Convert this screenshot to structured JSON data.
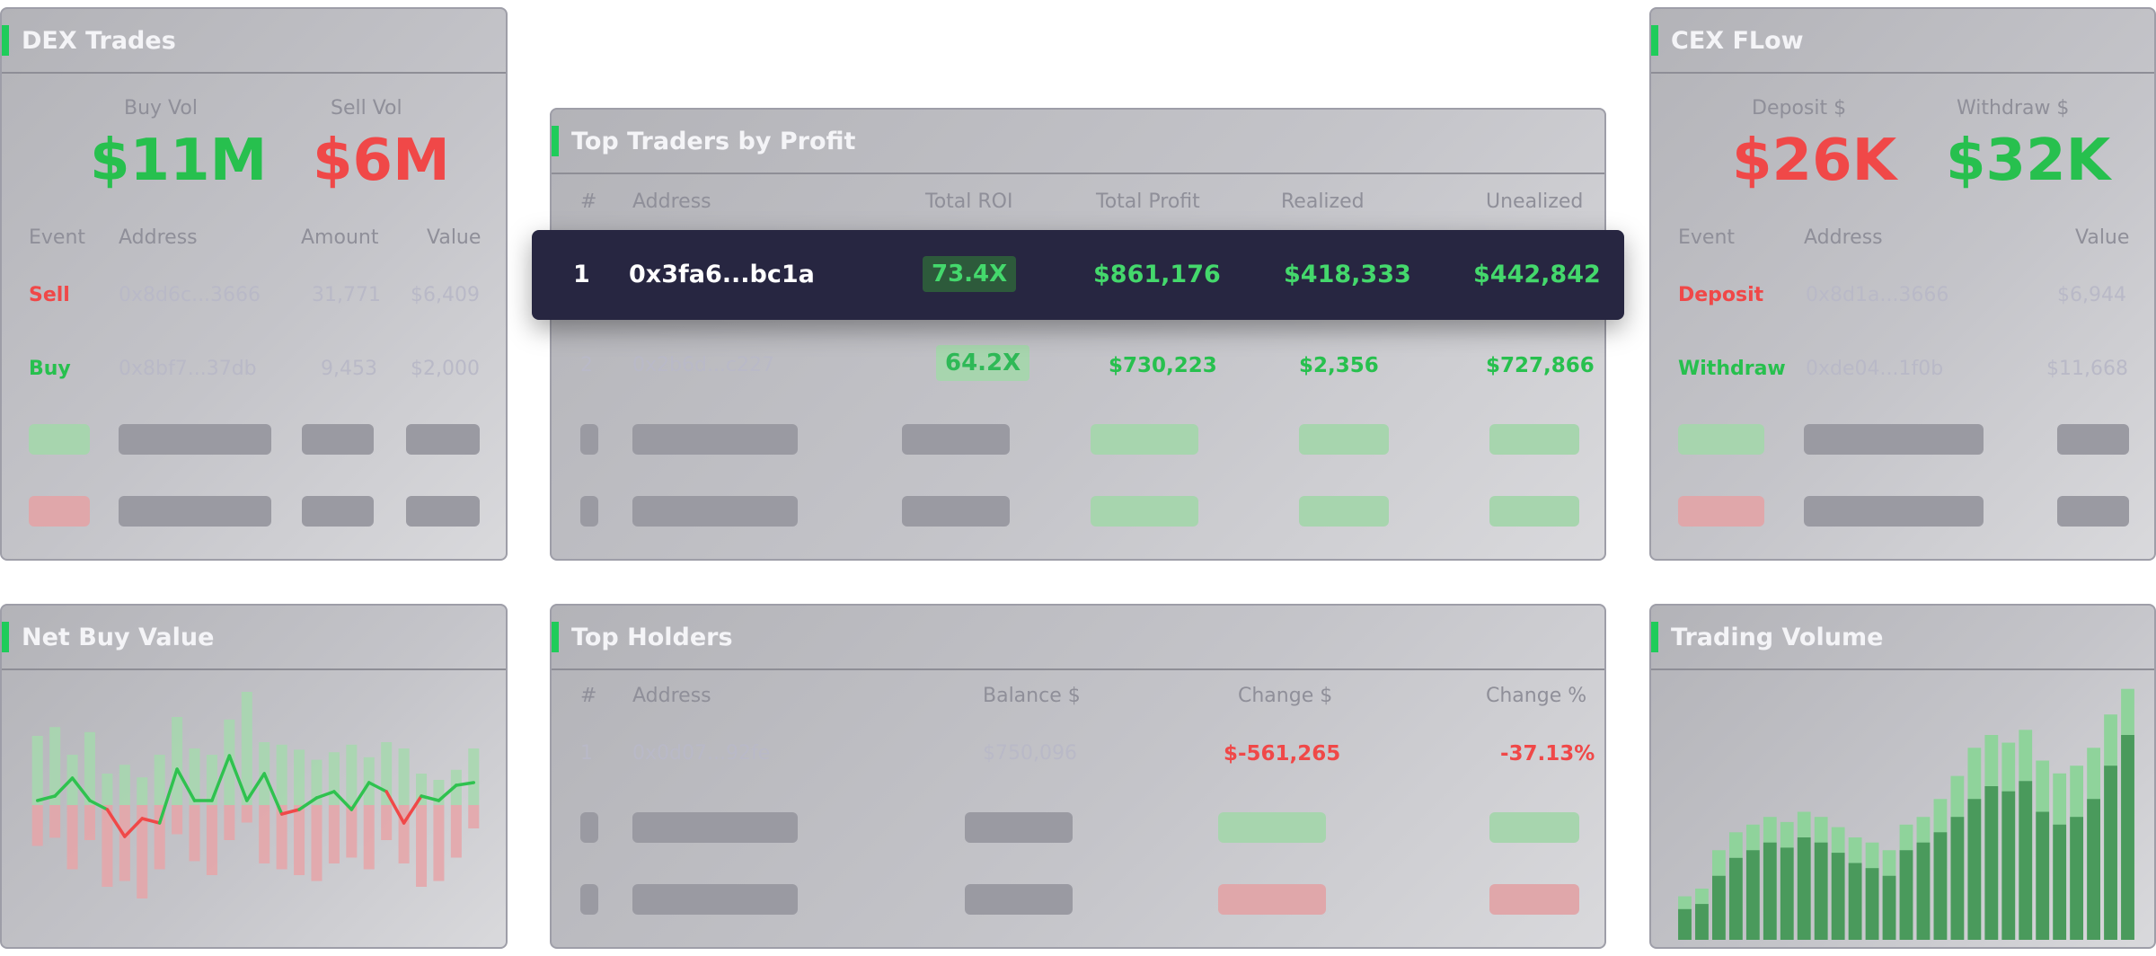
{
  "dex_trades": {
    "title": "DEX Trades",
    "buy_vol_label": "Buy Vol",
    "buy_vol_value": "$11M",
    "sell_vol_label": "Sell Vol",
    "sell_vol_value": "$6M",
    "headers": {
      "event": "Event",
      "address": "Address",
      "amount": "Amount",
      "value": "Value"
    },
    "rows": [
      {
        "event": "Sell",
        "address": "0x8d6c...3666",
        "amount": "31,771",
        "value": "$6,409"
      },
      {
        "event": "Buy",
        "address": "0x8bf7...37db",
        "amount": "9,453",
        "value": "$2,000"
      }
    ]
  },
  "top_traders": {
    "title": "Top Traders by Profit",
    "headers": {
      "rank": "#",
      "address": "Address",
      "roi": "Total ROI",
      "profit": "Total Profit",
      "realized": "Realized",
      "unrealized": "Unealized"
    },
    "rows": [
      {
        "rank": "1",
        "address": "0x3fa6...bc1a",
        "roi": "73.4X",
        "profit": "$861,176",
        "realized": "$418,333",
        "unrealized": "$442,842"
      },
      {
        "rank": "2",
        "address": "0x2b6d...c227",
        "roi": "64.2X",
        "profit": "$730,223",
        "realized": "$2,356",
        "unrealized": "$727,866"
      }
    ]
  },
  "cex_flow": {
    "title": "CEX FLow",
    "deposit_label": "Deposit $",
    "deposit_value": "$26K",
    "withdraw_label": "Withdraw $",
    "withdraw_value": "$32K",
    "headers": {
      "event": "Event",
      "address": "Address",
      "value": "Value"
    },
    "rows": [
      {
        "event": "Deposit",
        "address": "0x8d1a...3666",
        "value": "$6,944"
      },
      {
        "event": "Withdraw",
        "address": "0xde04...1f0b",
        "value": "$11,668"
      }
    ]
  },
  "net_buy_value": {
    "title": "Net Buy Value"
  },
  "top_holders": {
    "title": "Top Holders",
    "headers": {
      "rank": "#",
      "address": "Address",
      "balance": "Balance $",
      "change": "Change $",
      "change_pct": "Change %"
    },
    "rows": [
      {
        "rank": "1",
        "address": "0x0d07...92fe",
        "balance": "$750,096",
        "change": "$-561,265",
        "change_pct": "-37.13%"
      }
    ]
  },
  "trading_volume": {
    "title": "Trading Volume"
  },
  "colors": {
    "green": "#27c04e",
    "red": "#f04848",
    "highlight_row": "#272641",
    "accent": "#1fcc5a"
  },
  "chart_data": [
    {
      "type": "line",
      "title": "Net Buy Value",
      "up_bars": [
        0.55,
        0.62,
        0.4,
        0.58,
        0.25,
        0.32,
        0.22,
        0.4,
        0.7,
        0.45,
        0.4,
        0.68,
        0.9,
        0.5,
        0.48,
        0.44,
        0.36,
        0.42,
        0.48,
        0.38,
        0.5,
        0.45,
        0.25,
        0.2,
        0.28,
        0.45
      ],
      "down_bars": [
        0.35,
        0.28,
        0.55,
        0.3,
        0.7,
        0.65,
        0.8,
        0.55,
        0.25,
        0.48,
        0.6,
        0.3,
        0.15,
        0.5,
        0.55,
        0.6,
        0.65,
        0.5,
        0.45,
        0.55,
        0.3,
        0.5,
        0.7,
        0.65,
        0.45,
        0.2
      ],
      "line": [
        0.05,
        0.1,
        0.3,
        0.05,
        -0.05,
        -0.35,
        -0.15,
        -0.2,
        0.4,
        0.05,
        0.05,
        0.55,
        0.05,
        0.35,
        -0.1,
        -0.05,
        0.08,
        0.15,
        -0.05,
        0.25,
        0.15,
        -0.2,
        0.1,
        0.05,
        0.22,
        0.25
      ]
    },
    {
      "type": "bar",
      "title": "Trading Volume",
      "totals": [
        0.17,
        0.2,
        0.35,
        0.42,
        0.45,
        0.48,
        0.46,
        0.5,
        0.48,
        0.44,
        0.4,
        0.38,
        0.35,
        0.45,
        0.48,
        0.55,
        0.64,
        0.75,
        0.8,
        0.77,
        0.82,
        0.7,
        0.65,
        0.68,
        0.75,
        0.88,
        0.98
      ],
      "inner": [
        0.12,
        0.14,
        0.25,
        0.32,
        0.35,
        0.38,
        0.36,
        0.4,
        0.38,
        0.34,
        0.3,
        0.28,
        0.25,
        0.35,
        0.38,
        0.42,
        0.48,
        0.55,
        0.6,
        0.58,
        0.62,
        0.5,
        0.45,
        0.48,
        0.55,
        0.68,
        0.8
      ]
    }
  ]
}
